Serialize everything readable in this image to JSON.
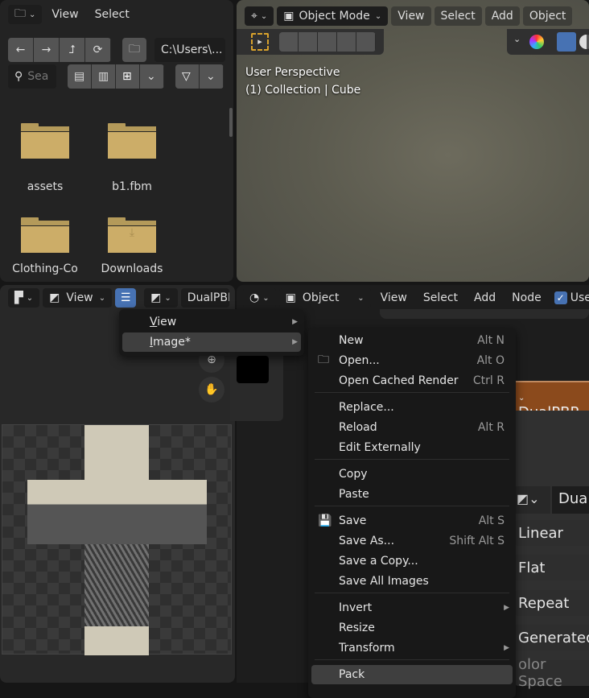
{
  "file_browser": {
    "menus": [
      "View",
      "Select"
    ],
    "nav_icons": [
      "arrow-left-icon",
      "arrow-right-icon",
      "parent-dir-icon",
      "refresh-icon"
    ],
    "path": "C:\\Users\\...",
    "search_placeholder": "Sea",
    "items": [
      {
        "name": "assets"
      },
      {
        "name": "b1.fbm"
      },
      {
        "name": "Clothing-Co"
      },
      {
        "name": "Downloads"
      }
    ]
  },
  "viewport": {
    "mode": "Object Mode",
    "menus": [
      "View",
      "Select",
      "Add",
      "Object"
    ],
    "overlay_line1": "User Perspective",
    "overlay_line2": "(1) Collection | Cube"
  },
  "image_editor": {
    "view_label": "View",
    "image_name": "DualPBI"
  },
  "node_editor": {
    "object_label": "Object",
    "menus": [
      "View",
      "Select",
      "Add",
      "Node"
    ],
    "use_label": "Use",
    "node_title": "DualPBR",
    "image_field": "Dua",
    "rows": [
      "Linear",
      "Flat",
      "Repeat",
      "Generated",
      "olor Space"
    ]
  },
  "main_menu": {
    "items": [
      {
        "label": "View",
        "ul": "V",
        "rest": "iew"
      },
      {
        "label": "Image*",
        "ul": "I",
        "rest": "mage*"
      }
    ]
  },
  "image_menu": {
    "items": [
      {
        "label": "New",
        "shortcut": "Alt N"
      },
      {
        "label": "Open...",
        "shortcut": "Alt O"
      },
      {
        "label": "Open Cached Render",
        "shortcut": "Ctrl R"
      },
      {
        "label": "Replace...",
        "shortcut": ""
      },
      {
        "label": "Reload",
        "shortcut": "Alt R"
      },
      {
        "label": "Edit Externally",
        "shortcut": ""
      },
      {
        "label": "Copy",
        "shortcut": ""
      },
      {
        "label": "Paste",
        "shortcut": ""
      },
      {
        "label": "Save",
        "shortcut": "Alt S"
      },
      {
        "label": "Save As...",
        "shortcut": "Shift Alt S"
      },
      {
        "label": "Save a Copy...",
        "shortcut": ""
      },
      {
        "label": "Save All Images",
        "shortcut": ""
      },
      {
        "label": "Invert",
        "shortcut": ""
      },
      {
        "label": "Resize",
        "shortcut": ""
      },
      {
        "label": "Transform",
        "shortcut": ""
      },
      {
        "label": "Pack",
        "shortcut": ""
      }
    ]
  },
  "colors": {
    "accent": "#4772b3",
    "folder": "#ccad68",
    "node_header": "#8b4a1c"
  }
}
